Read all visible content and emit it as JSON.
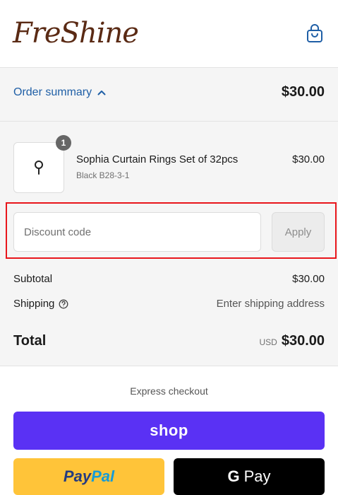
{
  "header": {
    "logo_text": "FreShine",
    "cart_icon": "shopping-bag-icon"
  },
  "summary": {
    "toggle_label": "Order summary",
    "toggle_icon": "chevron-up-icon",
    "total_display": "$30.00",
    "items": [
      {
        "name": "Sophia Curtain Rings Set of 32pcs",
        "variant": "Black B28-3-1",
        "price": "$30.00",
        "quantity": "1",
        "thumb_icon": "curtain-ring-icon"
      }
    ],
    "discount": {
      "placeholder": "Discount code",
      "value": "",
      "apply_label": "Apply"
    },
    "lines": {
      "subtotal_label": "Subtotal",
      "subtotal_value": "$30.00",
      "shipping_label": "Shipping",
      "shipping_help_icon": "question-circle-icon",
      "shipping_value": "Enter shipping address",
      "total_label": "Total",
      "total_currency": "USD",
      "total_value": "$30.00"
    }
  },
  "express": {
    "label": "Express checkout",
    "shop_label": "shop",
    "paypal_label_a": "Pay",
    "paypal_label_b": "Pal",
    "gpay_g": "G",
    "gpay_label": "Pay"
  },
  "colors": {
    "brand": "#5a2a14",
    "link": "#1f5fa6",
    "shop": "#5a31f4",
    "paypal": "#ffc439",
    "gpay": "#000000",
    "highlight": "#e8161c"
  }
}
